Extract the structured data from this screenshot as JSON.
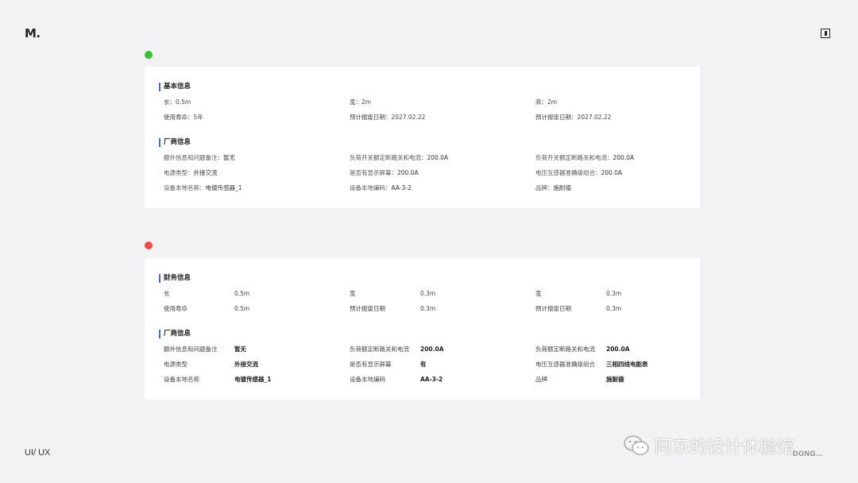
{
  "logo": "M.",
  "colors": {
    "green_dot": "#2fc12f",
    "red_dot": "#ee4d45",
    "accent": "#3b6fd8"
  },
  "card1": {
    "basic": {
      "title": "基本信息",
      "rows": [
        [
          "长：0.5m",
          "宽：2m",
          "高：2m"
        ],
        [
          "使用寿命：5年",
          "预计报废日期：2027.02.22",
          "预计报废日期：2027.02.22"
        ]
      ]
    },
    "vendor": {
      "title": "厂商信息",
      "rows": [
        [
          {
            "label": "额外信息和问题备注：",
            "value": "暂无"
          },
          {
            "label": "负荷开关额定断路关和电流：",
            "value": "200.0A"
          },
          {
            "label": "负荷开关额定断路关和电流：",
            "value": "200.0A"
          }
        ],
        [
          {
            "label": "电源类型：",
            "value": "外接交流"
          },
          {
            "label": "是否有显示屏幕：",
            "value": "200.0A"
          },
          {
            "label": "电压互感器准确级组合：",
            "value": "200.0A"
          }
        ],
        [
          {
            "label": "设备本地名称：",
            "value": "电镀传感器_1"
          },
          {
            "label": "设备本地编码：",
            "value": "AA-3-2"
          },
          {
            "label": "品牌：",
            "value": "施耐德"
          }
        ]
      ]
    }
  },
  "card2": {
    "finance": {
      "title": "财务信息",
      "rows": [
        [
          {
            "label": "长",
            "value": "0.5m"
          },
          {
            "label": "宽",
            "value": "0.3m"
          },
          {
            "label": "宽",
            "value": "0.3m"
          }
        ],
        [
          {
            "label": "使用寿命",
            "value": "0.5m"
          },
          {
            "label": "预计报废日期",
            "value": "0.3m"
          },
          {
            "label": "预计报废日期",
            "value": "0.3m"
          }
        ]
      ]
    },
    "vendor": {
      "title": "厂商信息",
      "rows": [
        [
          {
            "label": "额外信息和问题备注",
            "value": "暂无"
          },
          {
            "label": "负荷额定断路关和电流",
            "value": "200.0A"
          },
          {
            "label": "负荷额定断路关和电流",
            "value": "200.0A"
          }
        ],
        [
          {
            "label": "电源类型",
            "value": "外接交流"
          },
          {
            "label": "是否有显示屏幕",
            "value": "有"
          },
          {
            "label": "电压互感器准确级组合",
            "value": "三相四线电能表"
          }
        ],
        [
          {
            "label": "设备本地名称",
            "value": "电镀传感器_1"
          },
          {
            "label": "设备本地编码",
            "value": "AA-3-2"
          },
          {
            "label": "品牌",
            "value": "施耐德"
          }
        ]
      ]
    }
  },
  "footer": {
    "left": "UI/ UX",
    "watermark": "阿东的设计体验馆",
    "right": "DONG..."
  }
}
